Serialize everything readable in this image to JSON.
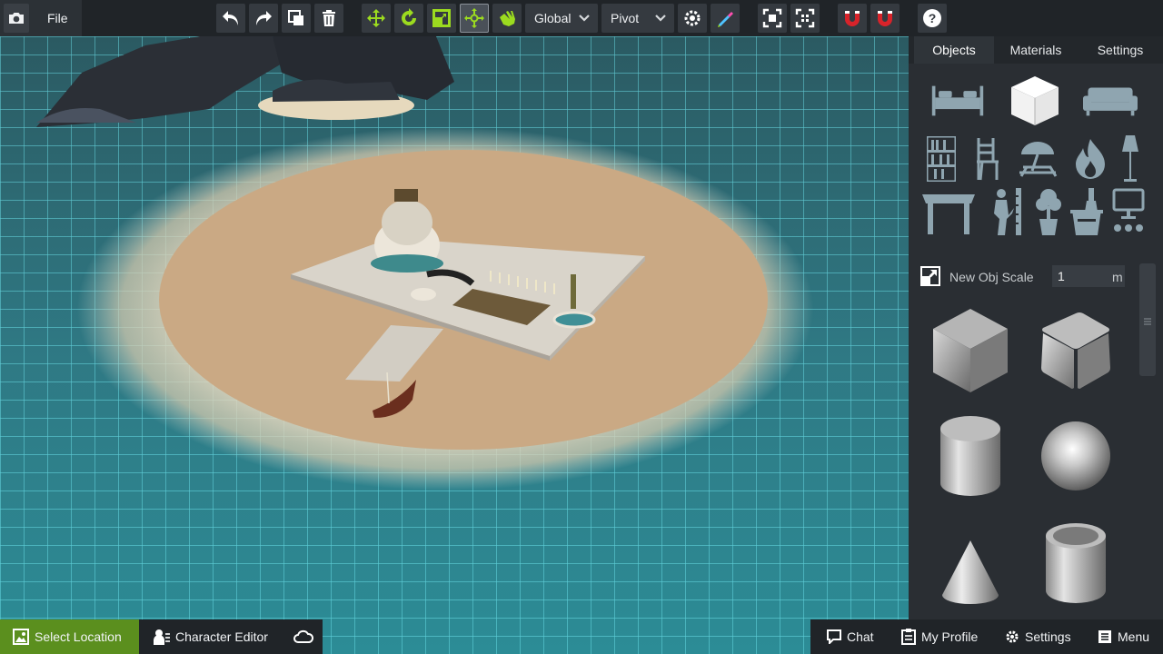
{
  "app": {
    "file_label": "File"
  },
  "toolbar": {
    "space_dropdown": "Global",
    "pivot_dropdown": "Pivot",
    "colors": {
      "accent": "#9cdb1f",
      "magnet": "#d8232a",
      "bg": "#353a40"
    }
  },
  "panel": {
    "tabs": [
      "Objects",
      "Materials",
      "Settings"
    ],
    "categories": [
      "bed-icon",
      "cube-icon",
      "sofa-icon",
      "bookshelf-icon",
      "chair-icon",
      "beach-umbrella-icon",
      "fire-icon",
      "lamp-icon",
      "table-icon",
      "measure-icon",
      "plant-icon",
      "bucket-icon",
      "computer-icon"
    ],
    "scale_label": "New Obj Scale",
    "scale_value": "1",
    "scale_unit": "m",
    "primitives": [
      "cube",
      "rounded-cube",
      "cylinder",
      "sphere",
      "cone",
      "tube"
    ]
  },
  "bottom": {
    "select_location": "Select Location",
    "character_editor": "Character Editor",
    "chat": "Chat",
    "my_profile": "My Profile",
    "settings": "Settings",
    "menu": "Menu"
  }
}
